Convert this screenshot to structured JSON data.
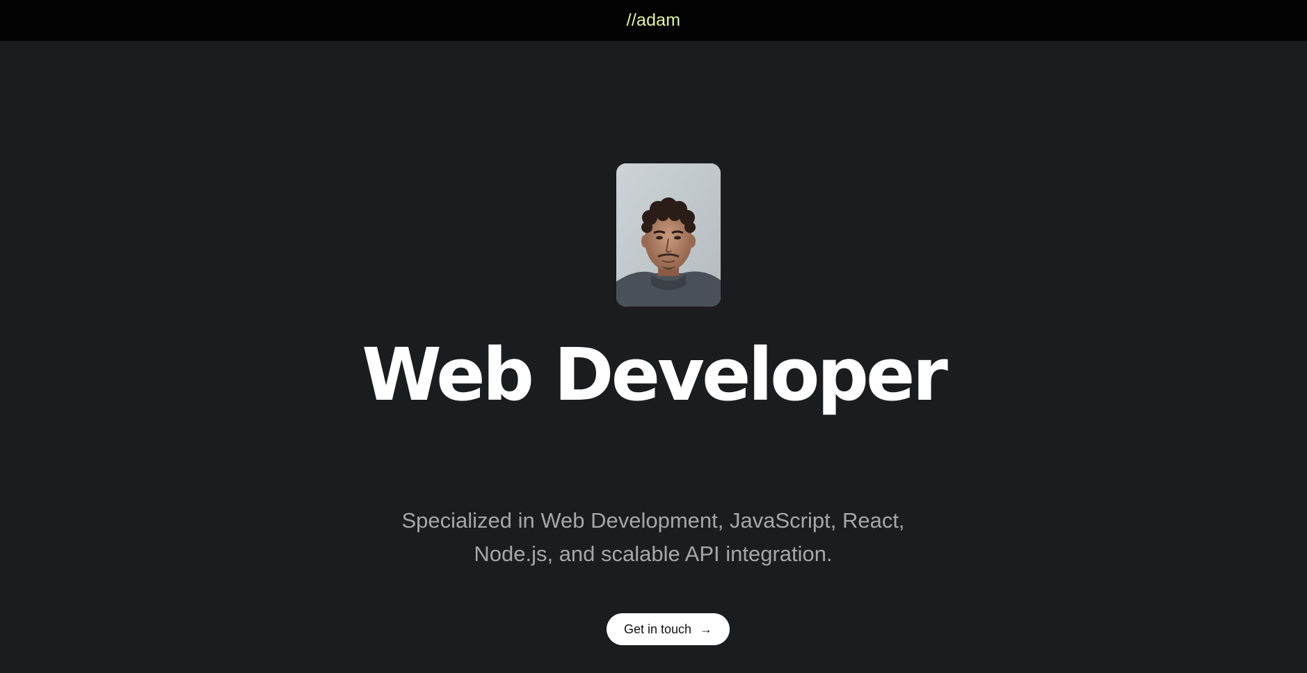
{
  "header": {
    "logo_text": "//adam",
    "logo_color": "#e2f59a"
  },
  "hero": {
    "portrait_alt": "Portrait photo",
    "headline": "Web Developer",
    "subtitle": "Specialized in Web Development, JavaScript, React, Node.js, and scalable API integration.",
    "cta_label": "Get in touch",
    "cta_icon": "arrow-right-icon",
    "cta_arrow": "→"
  },
  "colors": {
    "background": "#1b1c1e",
    "topbar": "#030303",
    "headline": "#ffffff",
    "subtitle": "#a6a7ab",
    "button_bg": "#ffffff"
  }
}
